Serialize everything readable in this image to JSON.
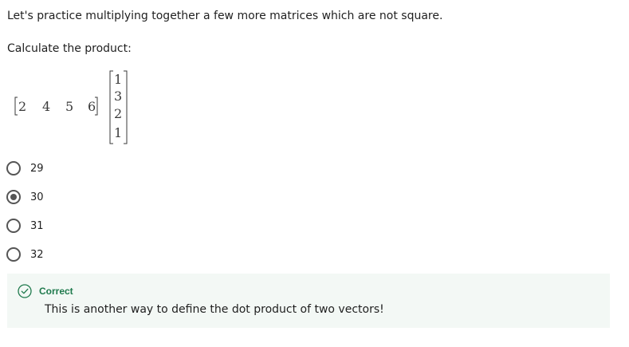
{
  "question": {
    "intro": "Let's practice multiplying together a few more matrices which are not square.",
    "prompt": "Calculate the product:",
    "row_vector": [
      "2",
      "4",
      "5",
      "6"
    ],
    "column_vector": [
      "1",
      "3",
      "2",
      "1"
    ]
  },
  "options": [
    {
      "label": "29",
      "selected": false
    },
    {
      "label": "30",
      "selected": true
    },
    {
      "label": "31",
      "selected": false
    },
    {
      "label": "32",
      "selected": false
    }
  ],
  "feedback": {
    "status": "Correct",
    "message": "This is another way to define the dot product of two vectors!",
    "icon": "check-circle-icon",
    "color": "#1f7a4d",
    "background": "#f3f8f5"
  }
}
